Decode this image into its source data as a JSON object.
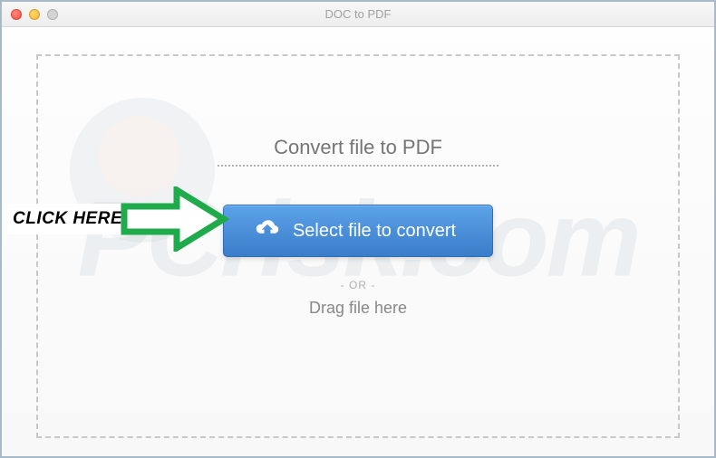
{
  "window": {
    "title": "DOC to PDF"
  },
  "main": {
    "heading": "Convert file to PDF",
    "selectButtonLabel": "Select file to convert",
    "orDivider": "- OR -",
    "dragText": "Drag file here"
  },
  "annotation": {
    "clickHere": "CLICK HERE"
  },
  "watermark": {
    "text": "PCrisk.com"
  }
}
